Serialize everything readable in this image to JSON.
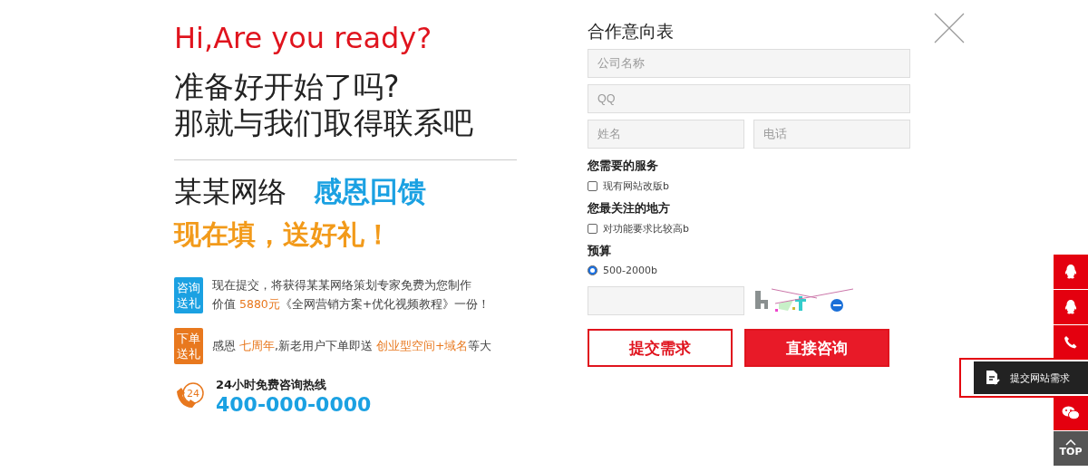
{
  "intro": {
    "greeting": "Hi,Are you ready?",
    "headline_lines": [
      "准备好开始了吗?",
      "那就与我们取得联系吧"
    ],
    "brand": "某某网络",
    "slogan": "感恩回馈",
    "call_to_action": "现在填，送好礼！"
  },
  "offers": [
    {
      "badge_lines": [
        "咨询",
        "送礼"
      ],
      "color": "#1ba1e2",
      "lines": [
        [
          {
            "text": "现在提交，将获得某某网络策划专家免费为您制作",
            "highlight": false
          }
        ],
        [
          {
            "text": "价值 ",
            "highlight": false
          },
          {
            "text": "5880元",
            "highlight": true
          },
          {
            "text": "《全网营销方案+优化视频教程》一份！",
            "highlight": false
          }
        ]
      ]
    },
    {
      "badge_lines": [
        "下单",
        "送礼"
      ],
      "color": "#e8781e",
      "lines": [
        [
          {
            "text": "感恩 ",
            "highlight": false
          },
          {
            "text": "七周年",
            "highlight": true
          },
          {
            "text": ",新老用户下单即送 ",
            "highlight": false
          },
          {
            "text": "创业型空间+域名",
            "highlight": true
          },
          {
            "text": "等大",
            "highlight": false
          }
        ]
      ]
    }
  ],
  "hotline": {
    "label": "24小时免费咨询热线",
    "number": "400-000-0000",
    "badge": "24"
  },
  "form": {
    "title": "合作意向表",
    "field_rows": [
      [
        {
          "placeholder": "公司名称"
        }
      ],
      [
        {
          "placeholder": "QQ"
        }
      ],
      [
        {
          "placeholder": "姓名"
        },
        {
          "placeholder": "电话"
        }
      ]
    ],
    "groups": [
      {
        "title": "您需要的服务",
        "kind": "checkbox",
        "options": [
          {
            "label": "现有网站改版b",
            "selected": false
          }
        ]
      },
      {
        "title": "您最关注的地方",
        "kind": "checkbox",
        "options": [
          {
            "label": "对功能要求比较高b",
            "selected": false
          }
        ]
      },
      {
        "title": "预算",
        "kind": "radio",
        "options": [
          {
            "label": "500-2000b",
            "selected": true
          }
        ]
      }
    ],
    "buttons": [
      {
        "label": "提交需求",
        "kind": "outline"
      },
      {
        "label": "直接咨询",
        "kind": "solid"
      }
    ]
  },
  "side_tools": [
    {
      "kind": "qq"
    },
    {
      "kind": "qq"
    },
    {
      "kind": "phone"
    },
    {
      "kind": "form",
      "expanded": true,
      "label": "提交网站需求"
    },
    {
      "kind": "wechat"
    },
    {
      "kind": "top",
      "label": "TOP"
    }
  ]
}
